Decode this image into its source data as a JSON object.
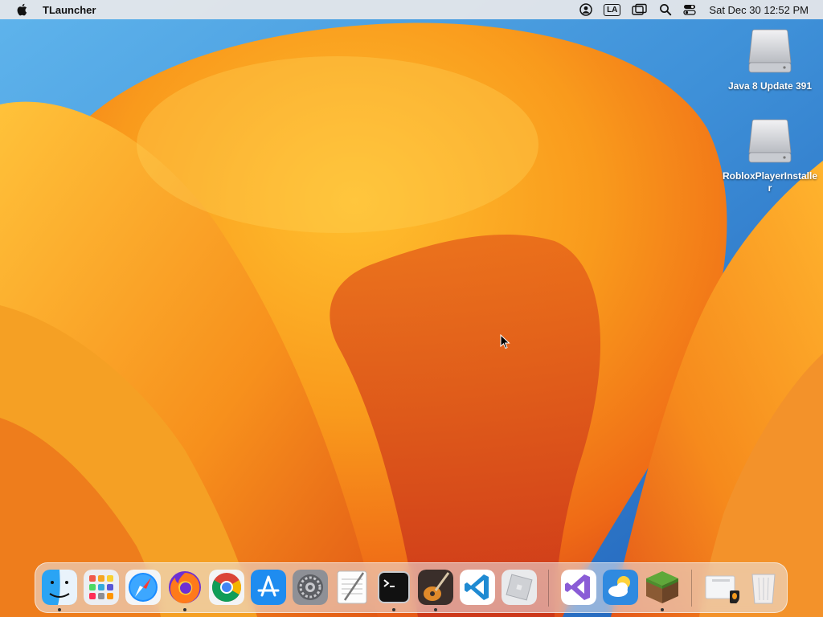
{
  "menubar": {
    "app_name": "TLauncher",
    "input_source": "LA",
    "clock": "Sat Dec 30  12:52 PM"
  },
  "desktop_icons": [
    {
      "label": "Java 8 Update 391",
      "icon": "disk-image-icon"
    },
    {
      "label": "RobloxPlayerInstaller",
      "icon": "disk-image-icon"
    }
  ],
  "dock": {
    "apps": [
      {
        "name": "Finder",
        "running": true
      },
      {
        "name": "Launchpad",
        "running": false
      },
      {
        "name": "Safari",
        "running": false
      },
      {
        "name": "Firefox",
        "running": true
      },
      {
        "name": "Google Chrome",
        "running": false
      },
      {
        "name": "App Store",
        "running": false
      },
      {
        "name": "System Settings",
        "running": false
      },
      {
        "name": "TextEdit",
        "running": false
      },
      {
        "name": "Terminal",
        "running": true
      },
      {
        "name": "GarageBand",
        "running": true
      },
      {
        "name": "Visual Studio Code",
        "running": false
      },
      {
        "name": "Roblox",
        "running": false
      },
      {
        "name": "Visual Studio",
        "running": false
      },
      {
        "name": "Weather",
        "running": false
      },
      {
        "name": "Minecraft",
        "running": true
      },
      {
        "name": "Downloads",
        "running": false
      },
      {
        "name": "Trash",
        "running": false
      }
    ]
  },
  "colors": {
    "menubar_bg": "#e8e8ea",
    "wallpaper_blue": "#2f7fd0",
    "wallpaper_orange": "#f39a1e",
    "wallpaper_red": "#d9441a"
  }
}
